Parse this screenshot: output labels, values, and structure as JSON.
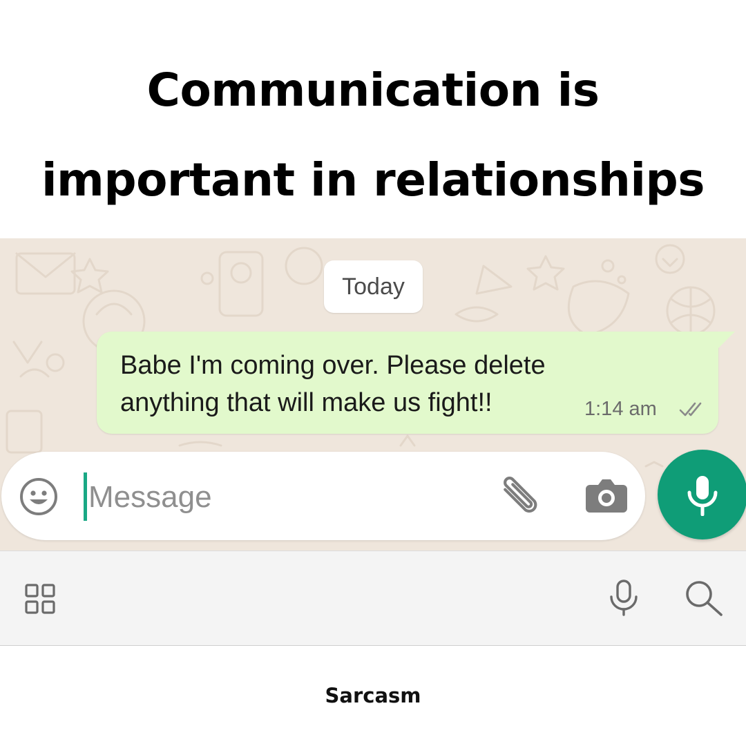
{
  "caption": {
    "line1": "Communication is",
    "line2": "important in relationships"
  },
  "chat": {
    "date_label": "Today",
    "message": {
      "line1": "Babe I'm coming over. Please delete",
      "line2": "anything that will make us fight!!",
      "time": "1:14 am",
      "status_icon": "double-check-icon"
    }
  },
  "composer": {
    "placeholder": "Message",
    "icons": [
      "emoji-icon",
      "paperclip-icon",
      "camera-icon",
      "microphone-icon"
    ]
  },
  "keyboard_bar": {
    "icons": [
      "apps-grid-icon",
      "voice-input-icon",
      "search-icon"
    ]
  },
  "footer": {
    "label": "Sarcasm"
  },
  "colors": {
    "chat_background": "#efe6dc",
    "outgoing_bubble": "#e2f9cc",
    "accent_green": "#0f9d77",
    "cursor": "#1aa885"
  }
}
